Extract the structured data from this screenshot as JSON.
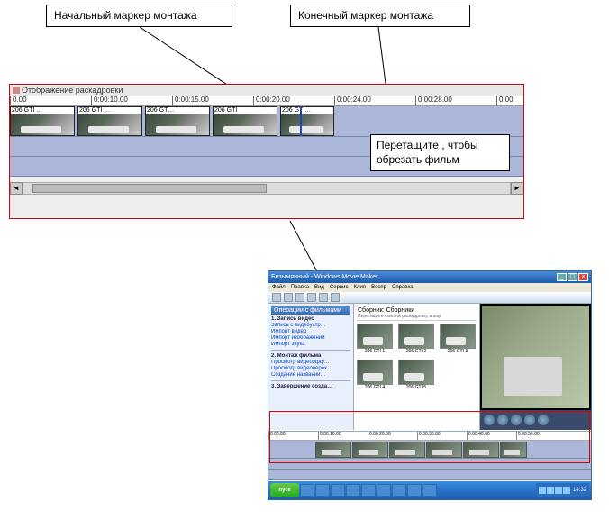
{
  "callouts": {
    "start_marker": "Начальный маркер монтажа",
    "end_marker": "Конечный маркер монтажа",
    "drag_tooltip": "Перетащите , чтобы обрезать фильм"
  },
  "timeline": {
    "title": "Отображение раскадровки",
    "ruler": [
      "0.00",
      "0:00:10.00",
      "0:00:15.00",
      "0:00:20.00",
      "0:00:24.00",
      "0:00:28.00",
      "0:00:"
    ],
    "clips": [
      {
        "label": "206 GTI …"
      },
      {
        "label": "206 GTI …"
      },
      {
        "label": "206 GT…"
      },
      {
        "label": "206 GTI"
      },
      {
        "label": "206 GTI…"
      }
    ]
  },
  "moviemaker": {
    "title": "Безымянный - Windows Movie Maker",
    "menu": [
      "Файл",
      "Правка",
      "Вид",
      "Сервис",
      "Клип",
      "Воспр",
      "Справка"
    ],
    "tasks_header": "Операции с фильмами",
    "tasks": [
      "1. Запись видео",
      "Запись с видеоустр…",
      "Импорт видео",
      "Импорт изображений",
      "Импорт звука",
      "2. Монтаж фильма",
      "Просмотр видеоэфф…",
      "Просмотр видеоперех…",
      "Создание названий…",
      "3. Завершение созда…"
    ],
    "collection_header": "Сборник: Сборники",
    "collection_sub": "Перетащите клип на раскадровку внизу.",
    "collection_items": [
      "206 GTI 1",
      "206 GTI 2",
      "206 GTI 3",
      "206 GTI 4",
      "206 GTI 5"
    ],
    "tl_ruler": [
      "0:00.00",
      "0:00:10.00",
      "0:00:20.00",
      "0:00:30.00",
      "0:00:40.00",
      "0:00:50.00"
    ],
    "tray_time": "14:32"
  }
}
